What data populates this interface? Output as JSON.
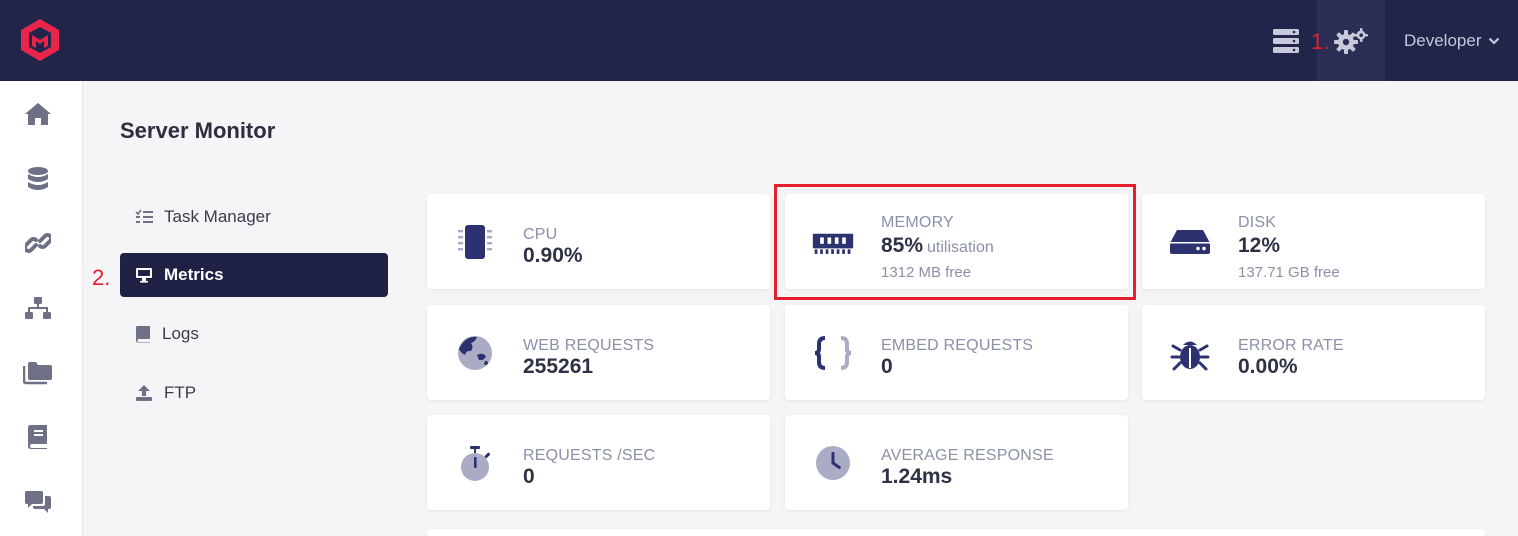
{
  "header": {
    "user_label": "Developer",
    "annotation_1": "1.",
    "brand_color": "#e8244a",
    "bar_color": "#212549"
  },
  "rail": {
    "items": [
      "home-icon",
      "database-icon",
      "link-icon",
      "sitemap-icon",
      "folders-icon",
      "book-icon",
      "comments-icon"
    ]
  },
  "page": {
    "title": "Server Monitor",
    "annotation_2": "2."
  },
  "subnav": [
    {
      "label": "Task Manager",
      "icon": "tasks-icon"
    },
    {
      "label": "Metrics",
      "icon": "desktop-icon",
      "active": true
    },
    {
      "label": "Logs",
      "icon": "book-icon"
    },
    {
      "label": "FTP",
      "icon": "upload-icon"
    }
  ],
  "metrics": {
    "cpu": {
      "label": "CPU",
      "value": "0.90%"
    },
    "memory": {
      "label": "MEMORY",
      "value": "85%",
      "suffix": "utilisation",
      "sub": "1312 MB free"
    },
    "disk": {
      "label": "DISK",
      "value": "12%",
      "sub": "137.71 GB free"
    },
    "web_requests": {
      "label": "WEB REQUESTS",
      "value": "255261"
    },
    "embed_requests": {
      "label": "EMBED REQUESTS",
      "value": "0"
    },
    "error_rate": {
      "label": "ERROR RATE",
      "value": "0.00%"
    },
    "requests_sec": {
      "label": "REQUESTS /SEC",
      "value": "0"
    },
    "avg_response": {
      "label": "AVERAGE RESPONSE",
      "value": "1.24ms"
    }
  },
  "colors": {
    "icon_dark": "#2c3270",
    "icon_light": "#a9acc4",
    "highlight": "#e3202c"
  }
}
